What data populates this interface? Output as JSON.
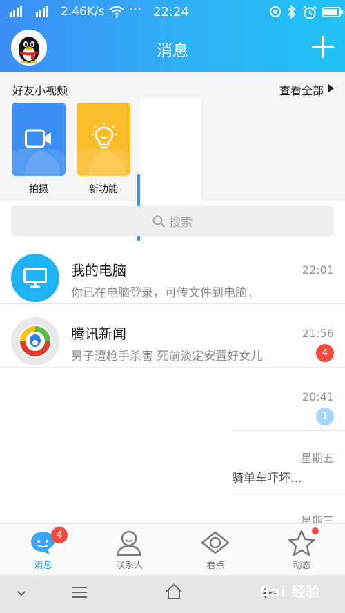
{
  "status_bar": {
    "network_speed": "2.46K/s",
    "more": "···",
    "time": "22:24"
  },
  "header": {
    "title": "消息"
  },
  "friend_videos": {
    "title": "好友小视频",
    "view_all": "查看全部",
    "tiles": [
      {
        "label": "拍摄",
        "color": "#3d8ef2"
      },
      {
        "label": "新功能",
        "color": "#fcbd2b"
      }
    ]
  },
  "search": {
    "placeholder": "搜索"
  },
  "conversations": [
    {
      "name": "我的电脑",
      "preview": "你已在电脑登录，可传文件到电脑。",
      "time": "22:01",
      "badge": ""
    },
    {
      "name": "腾讯新闻",
      "preview": "男子遭枪手杀害 死前淡定安置好女儿",
      "time": "21:56",
      "badge": "4",
      "badge_color": "#f24a3d"
    },
    {
      "name": "",
      "preview": "",
      "time": "20:41",
      "badge": "1",
      "badge_color": "#a6d8f4"
    },
    {
      "name": "",
      "preview": "骑单车吓坏…",
      "time": "星期五",
      "badge": ""
    },
    {
      "name": "",
      "preview": "",
      "time": "星期三",
      "badge": ""
    }
  ],
  "tabbar": {
    "tabs": [
      {
        "label": "消息",
        "badge": "4"
      },
      {
        "label": "联系人"
      },
      {
        "label": "看点"
      },
      {
        "label": "动态"
      }
    ]
  },
  "watermark": "Bai 经验",
  "colors": {
    "header_gradient_start": "#3c8ef7",
    "header_gradient_end": "#21c3f5",
    "badge_red": "#f24a3d",
    "accent_blue": "#2d9af5"
  }
}
